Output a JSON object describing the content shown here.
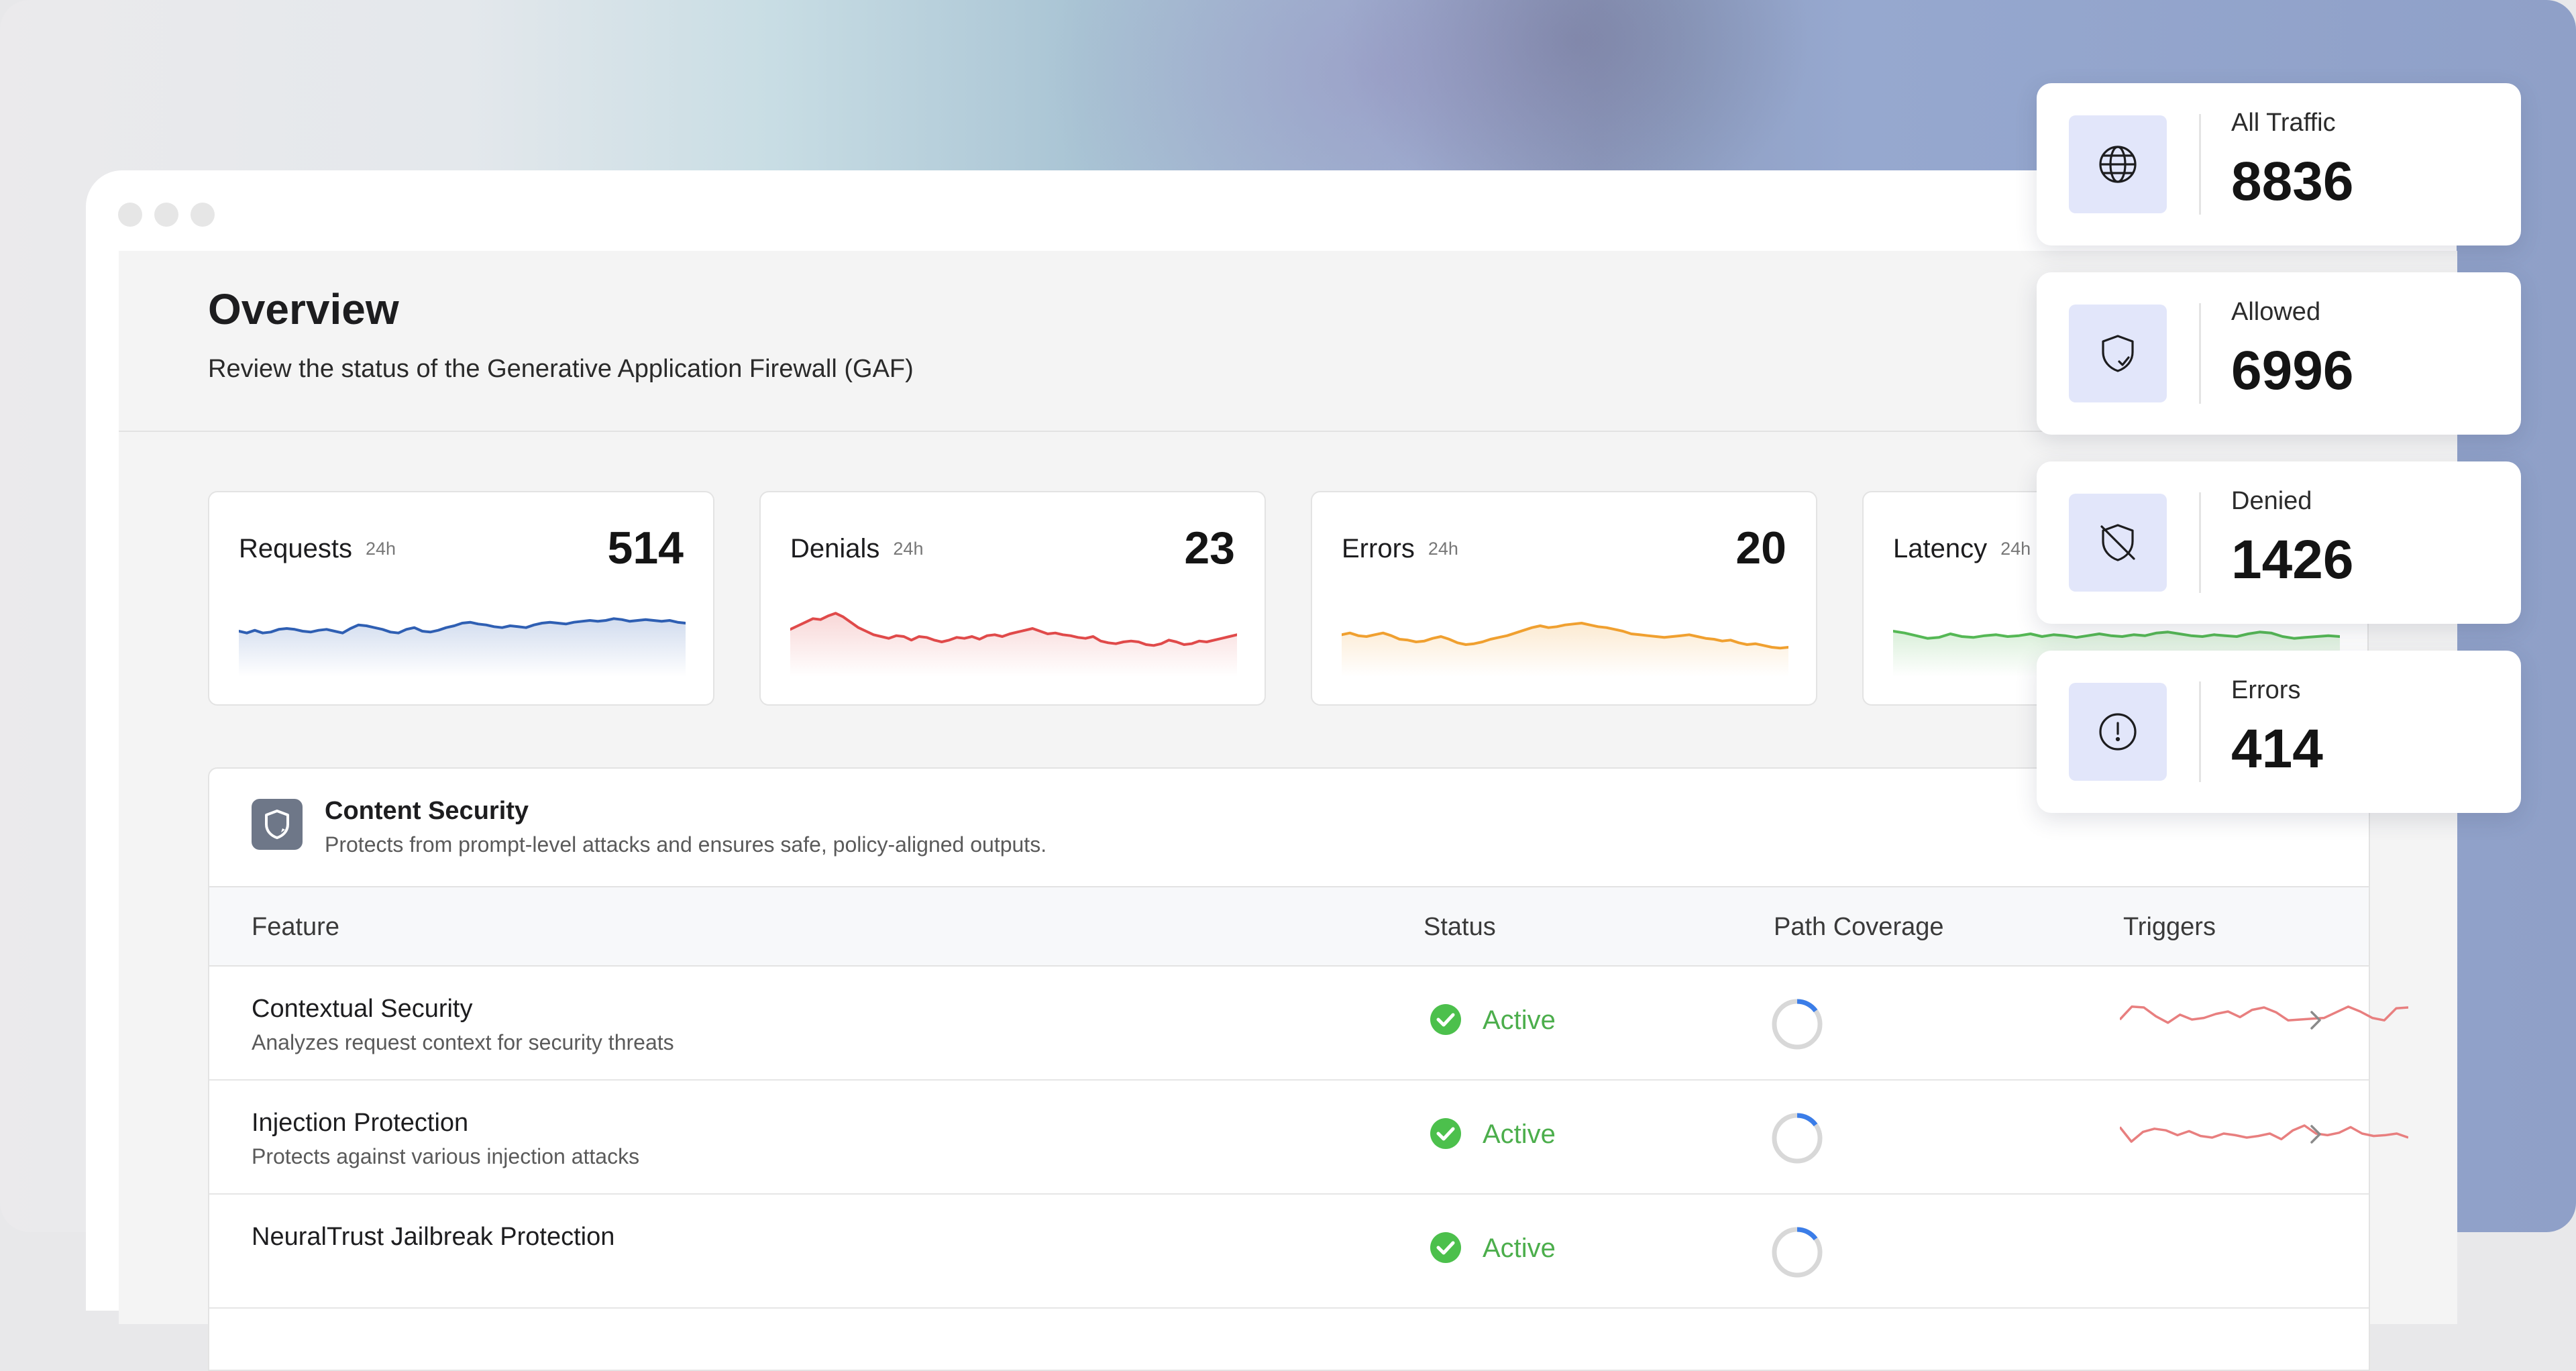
{
  "header": {
    "title": "Overview",
    "subtitle": "Review the status of the Generative Application Firewall (GAF)"
  },
  "metrics": [
    {
      "label": "Requests",
      "period": "24h",
      "value": "514",
      "color": "#2f5fb3",
      "trend": [
        36,
        34,
        37,
        34,
        35,
        38,
        39,
        38,
        36,
        35,
        37,
        38,
        36,
        34,
        39,
        43,
        42,
        40,
        38,
        35,
        34,
        38,
        40,
        36,
        35,
        37,
        40,
        42,
        45,
        46,
        44,
        43,
        41,
        40,
        42,
        41,
        40,
        43,
        45,
        46,
        45,
        44,
        46,
        47,
        48,
        47,
        48,
        50,
        49,
        47,
        48,
        49,
        48,
        47,
        48,
        46,
        45
      ]
    },
    {
      "label": "Denials",
      "period": "24h",
      "value": "23",
      "color": "#e04a4a",
      "trend": [
        38,
        42,
        46,
        50,
        49,
        53,
        56,
        52,
        46,
        40,
        36,
        32,
        30,
        28,
        31,
        30,
        26,
        30,
        29,
        26,
        24,
        26,
        29,
        28,
        30,
        27,
        31,
        32,
        30,
        33,
        35,
        37,
        39,
        36,
        33,
        34,
        32,
        31,
        29,
        28,
        30,
        25,
        23,
        22,
        24,
        25,
        24,
        21,
        20,
        22,
        26,
        24,
        21,
        22,
        25,
        24,
        26,
        28,
        30,
        32
      ]
    },
    {
      "label": "Errors",
      "period": "24h",
      "value": "20",
      "color": "#f0a030",
      "trend": [
        32,
        34,
        31,
        30,
        32,
        34,
        31,
        27,
        26,
        24,
        25,
        28,
        30,
        27,
        23,
        21,
        22,
        24,
        27,
        29,
        31,
        34,
        37,
        40,
        42,
        40,
        41,
        43,
        44,
        45,
        43,
        41,
        40,
        38,
        36,
        33,
        32,
        31,
        30,
        29,
        30,
        31,
        32,
        30,
        28,
        27,
        25,
        26,
        23,
        21,
        22,
        20,
        18,
        17,
        18
      ]
    },
    {
      "label": "Latency",
      "period": "24h",
      "value": "",
      "color": "#55b855",
      "trend": [
        36,
        34,
        31,
        28,
        29,
        33,
        30,
        29,
        31,
        32,
        30,
        31,
        33,
        30,
        32,
        31,
        29,
        31,
        33,
        31,
        30,
        32,
        31,
        34,
        35,
        33,
        31,
        30,
        32,
        31,
        30,
        33,
        35,
        34,
        30,
        28,
        29,
        30,
        31,
        30
      ]
    }
  ],
  "panel": {
    "title": "Content Security",
    "description": "Protects from prompt-level attacks and ensures safe, policy-aligned outputs.",
    "columns": [
      "Feature",
      "Status",
      "Path Coverage",
      "Triggers"
    ],
    "rows": [
      {
        "name": "Contextual Security",
        "description": "Analyzes request context for security threats",
        "status": "Active",
        "coverage": 0.15,
        "triggers": [
          30,
          46,
          45,
          34,
          26,
          36,
          30,
          32,
          37,
          40,
          33,
          42,
          45,
          39,
          29,
          30,
          31,
          32,
          39,
          46,
          40,
          32,
          29,
          44,
          45
        ]
      },
      {
        "name": "Injection Protection",
        "description": "Protects against various injection attacks",
        "status": "Active",
        "coverage": 0.15,
        "triggers": [
          38,
          20,
          32,
          36,
          34,
          28,
          33,
          27,
          25,
          30,
          28,
          25,
          27,
          30,
          23,
          34,
          40,
          30,
          28,
          31,
          38,
          30,
          27,
          28,
          30,
          25
        ]
      },
      {
        "name": "NeuralTrust Jailbreak Protection",
        "description": "",
        "status": "Active",
        "coverage": 0.15,
        "triggers": []
      }
    ]
  },
  "stats": [
    {
      "label": "All Traffic",
      "value": "8836",
      "icon": "globe-icon"
    },
    {
      "label": "Allowed",
      "value": "6996",
      "icon": "shield-check-icon"
    },
    {
      "label": "Denied",
      "value": "1426",
      "icon": "shield-off-icon"
    },
    {
      "label": "Errors",
      "value": "414",
      "icon": "alert-circle-icon"
    }
  ]
}
